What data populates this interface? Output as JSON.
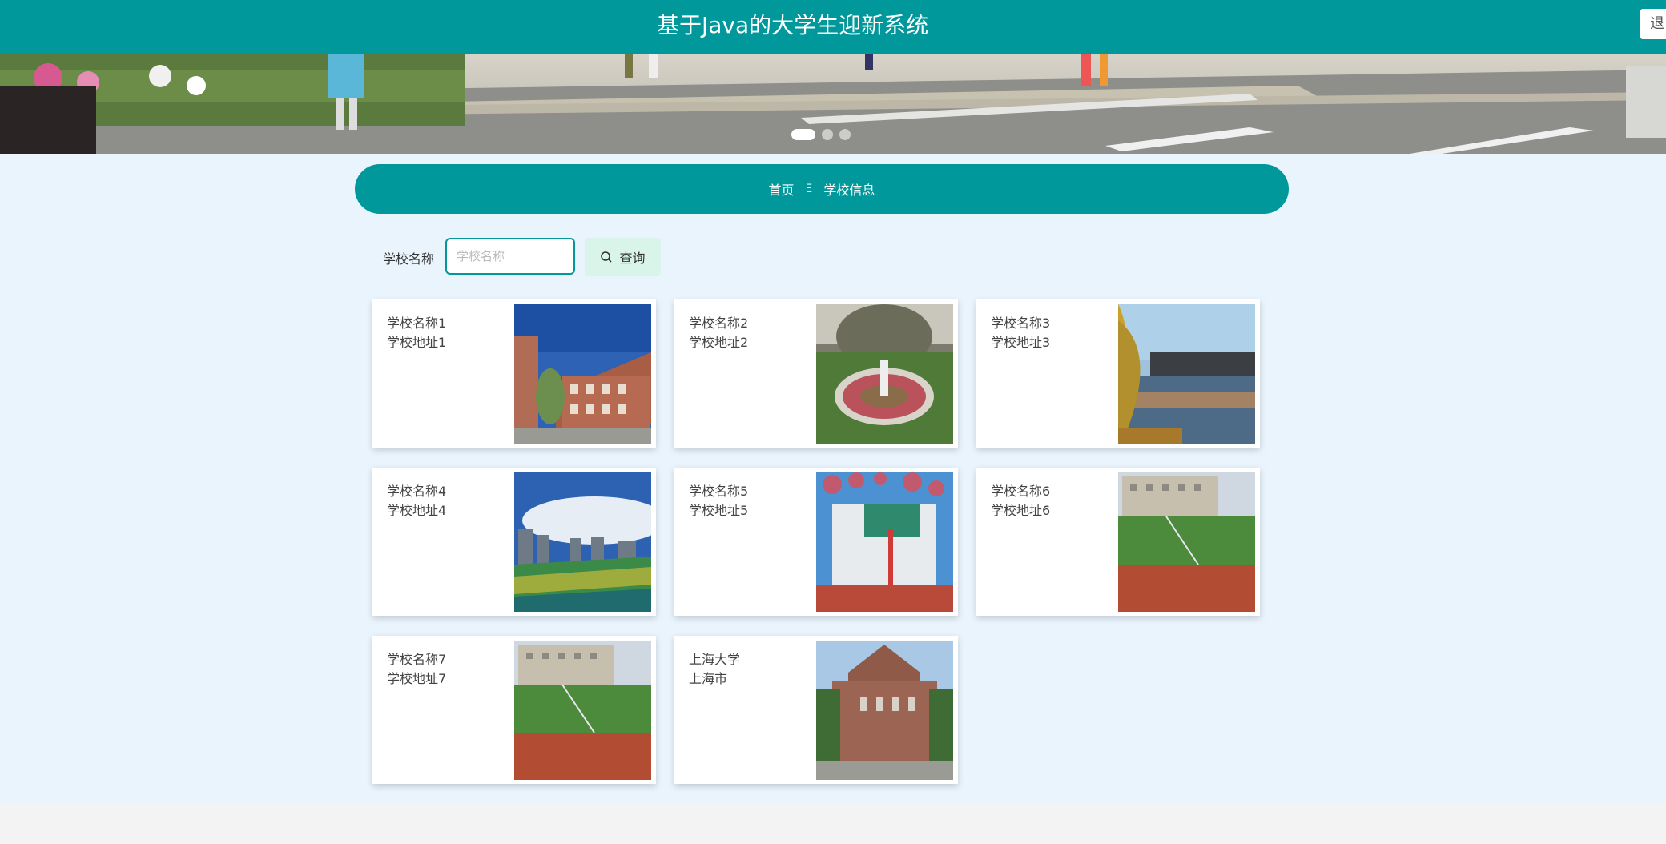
{
  "header": {
    "title": "基于Java的大学生迎新系统",
    "logout_label": "退"
  },
  "carousel": {
    "active_index": 0,
    "count": 3
  },
  "breadcrumb": {
    "home": "首页",
    "separator": "Ξ",
    "current": "学校信息"
  },
  "search": {
    "label": "学校名称",
    "placeholder": "学校名称",
    "value": "",
    "button_label": "查询"
  },
  "schools": [
    {
      "name": "学校名称1",
      "address": "学校地址1",
      "photo": "brick-building"
    },
    {
      "name": "学校名称2",
      "address": "学校地址2",
      "photo": "garden-roundabout"
    },
    {
      "name": "学校名称3",
      "address": "学校地址3",
      "photo": "lake-campus"
    },
    {
      "name": "学校名称4",
      "address": "学校地址4",
      "photo": "sports-field-city"
    },
    {
      "name": "学校名称5",
      "address": "学校地址5",
      "photo": "blossom-building"
    },
    {
      "name": "学校名称6",
      "address": "学校地址6",
      "photo": "running-track"
    },
    {
      "name": "学校名称7",
      "address": "学校地址7",
      "photo": "running-track"
    },
    {
      "name": "上海大学",
      "address": "上海市",
      "photo": "ivy-building"
    }
  ],
  "colors": {
    "primary": "#00989a",
    "page_bg": "#eaf4fd",
    "button_bg": "#d9f5ea"
  }
}
